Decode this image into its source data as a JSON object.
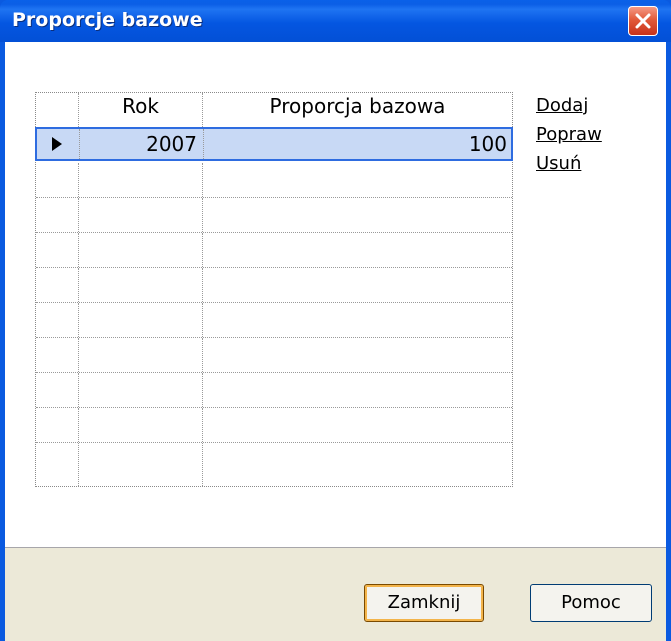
{
  "window": {
    "title": "Proporcje bazowe"
  },
  "table": {
    "columns": [
      "Rok",
      "Proporcja bazowa"
    ],
    "rows": [
      {
        "rok": "2007",
        "proporcja": "100",
        "selected": true
      }
    ],
    "empty_rows": 9
  },
  "actions": {
    "add": "Dodaj",
    "edit": "Popraw",
    "delete": "Usuń"
  },
  "buttons": {
    "close": "Zamknij",
    "help": "Pomoc"
  },
  "colors": {
    "titlebar": "#0456e1",
    "selection": "#c8d9f5",
    "footer": "#ece9d8"
  }
}
